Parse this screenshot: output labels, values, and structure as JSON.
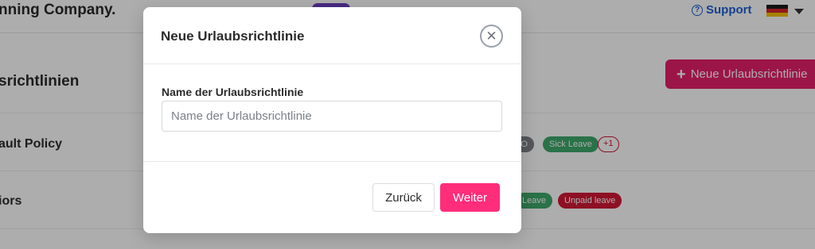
{
  "background": {
    "company_name": "nning Company.",
    "support_label": "Support",
    "support_icon": "help-circle-icon",
    "language_flag": "germany-flag-icon",
    "flag_colors": [
      "#1a1a1a",
      "#d6262b",
      "#f3c100"
    ],
    "section_title": "srichtlinien",
    "new_policy_button_label": "Neue Urlaubsrichtlinie",
    "rows": [
      {
        "title": "ault Policy",
        "tags": [
          "TO",
          "Sick Leave",
          "+1"
        ]
      },
      {
        "title": "iors",
        "tags": [
          "Leave",
          "Unpaid leave"
        ]
      }
    ]
  },
  "modal": {
    "title": "Neue Urlaubsrichtlinie",
    "close_icon": "close-icon",
    "field_label": "Name der Urlaubsrichtlinie",
    "field_value": "",
    "field_placeholder": "Name der Urlaubsrichtlinie",
    "back_label": "Zurück",
    "next_label": "Weiter",
    "accent_color": "#ff2d7a"
  }
}
